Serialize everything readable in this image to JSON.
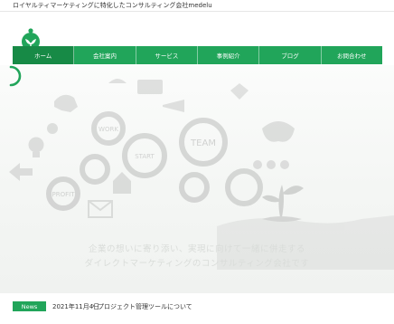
{
  "topbar": {
    "tagline": "ロイヤルティマーケティングに特化したコンサルティング会社medelu"
  },
  "nav": {
    "items": [
      {
        "label": "ホーム"
      },
      {
        "label": "会社案内"
      },
      {
        "label": "サービス"
      },
      {
        "label": "事例紹介"
      },
      {
        "label": "ブログ"
      },
      {
        "label": "お問合わせ"
      }
    ]
  },
  "hero": {
    "line1": "企業の想いに寄り添い、実現に向けて一緒に併走する",
    "line2": "ダイレクトマーケティングのコンサルティング会社です",
    "gear_words": [
      "WORK",
      "START",
      "TEAM",
      "PROFIT"
    ]
  },
  "news": {
    "badge": "News",
    "date": "2021年11月4日",
    "separator": "›",
    "title": "プロジェクト管理ツールについて"
  },
  "colors": {
    "brand_green": "#21a55a",
    "brand_green_dark": "#178a46"
  }
}
